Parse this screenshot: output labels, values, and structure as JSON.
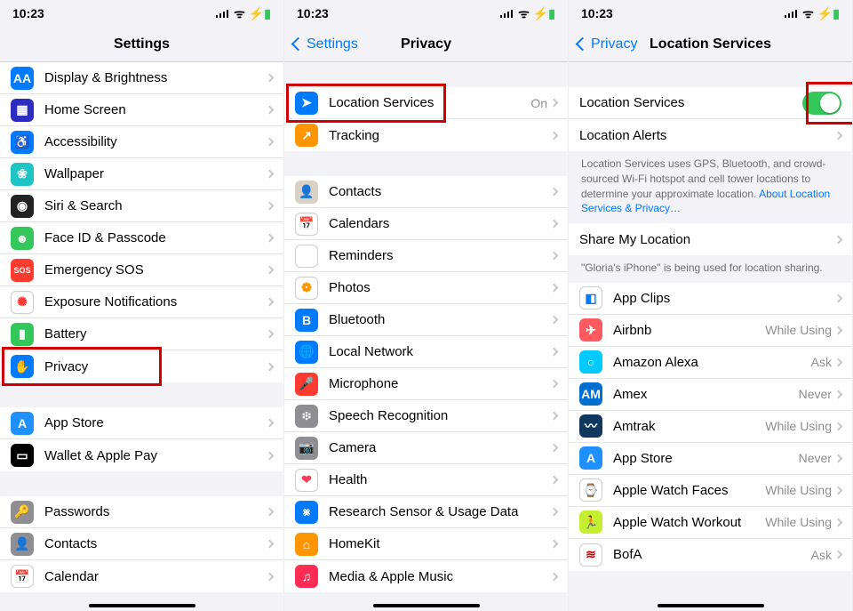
{
  "status": {
    "time": "10:23"
  },
  "screen1": {
    "title": "Settings",
    "section1": [
      {
        "label": "Display & Brightness",
        "icon_bg": "#007aff",
        "glyph": "AA"
      },
      {
        "label": "Home Screen",
        "icon_bg": "#2c2cbe",
        "glyph": "▦"
      },
      {
        "label": "Accessibility",
        "icon_bg": "#007aff",
        "glyph": "♿"
      },
      {
        "label": "Wallpaper",
        "icon_bg": "#1fc5c5",
        "glyph": "❀"
      },
      {
        "label": "Siri & Search",
        "icon_bg": "#222",
        "glyph": "◉"
      },
      {
        "label": "Face ID & Passcode",
        "icon_bg": "#34c759",
        "glyph": "☻"
      },
      {
        "label": "Emergency SOS",
        "icon_bg": "#ff3b30",
        "glyph": "SOS"
      },
      {
        "label": "Exposure Notifications",
        "icon_bg": "#fff",
        "glyph": "✺",
        "glyph_color": "#ff3b30",
        "border": true
      },
      {
        "label": "Battery",
        "icon_bg": "#34c759",
        "glyph": "▮"
      },
      {
        "label": "Privacy",
        "icon_bg": "#007aff",
        "glyph": "✋",
        "highlight": true
      }
    ],
    "section2": [
      {
        "label": "App Store",
        "icon_bg": "#1e90ff",
        "glyph": "A"
      },
      {
        "label": "Wallet & Apple Pay",
        "icon_bg": "#000",
        "glyph": "▭"
      }
    ],
    "section3": [
      {
        "label": "Passwords",
        "icon_bg": "#8e8e93",
        "glyph": "🔑"
      },
      {
        "label": "Contacts",
        "icon_bg": "#8e8e93",
        "glyph": "👤"
      },
      {
        "label": "Calendar",
        "icon_bg": "#fff",
        "glyph": "📅",
        "border": true
      }
    ]
  },
  "screen2": {
    "back": "Settings",
    "title": "Privacy",
    "sectionA": [
      {
        "label": "Location Services",
        "detail": "On",
        "icon_bg": "#007aff",
        "glyph": "➤",
        "highlight": true
      },
      {
        "label": "Tracking",
        "icon_bg": "#ff9500",
        "glyph": "↗"
      }
    ],
    "sectionB": [
      {
        "label": "Contacts",
        "icon_bg": "#d9d1c3",
        "glyph": "👤"
      },
      {
        "label": "Calendars",
        "icon_bg": "#fff",
        "glyph": "📅",
        "border": true
      },
      {
        "label": "Reminders",
        "icon_bg": "#fff",
        "glyph": "⋮",
        "border": true
      },
      {
        "label": "Photos",
        "icon_bg": "#fff",
        "glyph": "❁",
        "glyph_color": "#ff9500",
        "border": true
      },
      {
        "label": "Bluetooth",
        "icon_bg": "#007aff",
        "glyph": "B"
      },
      {
        "label": "Local Network",
        "icon_bg": "#007aff",
        "glyph": "🌐"
      },
      {
        "label": "Microphone",
        "icon_bg": "#ff3b30",
        "glyph": "🎤"
      },
      {
        "label": "Speech Recognition",
        "icon_bg": "#8e8e93",
        "glyph": "፨"
      },
      {
        "label": "Camera",
        "icon_bg": "#8e8e93",
        "glyph": "📷"
      },
      {
        "label": "Health",
        "icon_bg": "#fff",
        "glyph": "❤",
        "glyph_color": "#ff3b55",
        "border": true
      },
      {
        "label": "Research Sensor & Usage Data",
        "icon_bg": "#007aff",
        "glyph": "⨳"
      },
      {
        "label": "HomeKit",
        "icon_bg": "#ff9500",
        "glyph": "⌂"
      },
      {
        "label": "Media & Apple Music",
        "icon_bg": "#ff2d55",
        "glyph": "♫"
      }
    ]
  },
  "screen3": {
    "back": "Privacy",
    "title": "Location Services",
    "top_rows": {
      "switch_label": "Location Services",
      "alerts_label": "Location Alerts"
    },
    "explainer": "Location Services uses GPS, Bluetooth, and crowd-sourced Wi-Fi hotspot and cell tower locations to determine your approximate location.",
    "explainer_link": "About Location Services & Privacy…",
    "share": {
      "label": "Share My Location"
    },
    "share_footer": "\"Gloria's iPhone\" is being used for location sharing.",
    "apps": [
      {
        "label": "App Clips",
        "detail": "",
        "icon_bg": "#fff",
        "glyph": "◧",
        "glyph_color": "#007aff",
        "border": true
      },
      {
        "label": "Airbnb",
        "detail": "While Using",
        "icon_bg": "#ff5a5f",
        "glyph": "✈"
      },
      {
        "label": "Amazon Alexa",
        "detail": "Ask",
        "icon_bg": "#00caff",
        "glyph": "○"
      },
      {
        "label": "Amex",
        "detail": "Never",
        "icon_bg": "#006fcf",
        "glyph": "AM"
      },
      {
        "label": "Amtrak",
        "detail": "While Using",
        "icon_bg": "#10385f",
        "glyph": "〰"
      },
      {
        "label": "App Store",
        "detail": "Never",
        "icon_bg": "#1e90ff",
        "glyph": "A"
      },
      {
        "label": "Apple Watch Faces",
        "detail": "While Using",
        "icon_bg": "#fff",
        "glyph": "⌚",
        "border": true
      },
      {
        "label": "Apple Watch Workout",
        "detail": "While Using",
        "icon_bg": "#c5f02f",
        "glyph": "🏃"
      },
      {
        "label": "BofA",
        "detail": "Ask",
        "icon_bg": "#fff",
        "glyph": "≋",
        "glyph_color": "#cc0000",
        "border": true
      }
    ]
  }
}
